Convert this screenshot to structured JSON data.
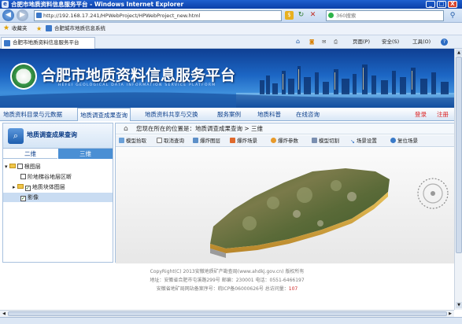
{
  "window": {
    "title": "合肥市地质资料信息服务平台 - Windows Internet Explorer",
    "min": "_",
    "max": "□",
    "close": "X"
  },
  "browser": {
    "back": "◀",
    "forward": "▶",
    "url": "http://192.168.17.241/HPWebProject/HPWebProject_new.html",
    "search_placeholder": "360搜索",
    "favorites_label": "收藏夹",
    "fav_link": "合肥城市地质信息系统",
    "tab_title": "合肥市地质资料信息服务平台",
    "cmd_page": "页面(P)",
    "cmd_safety": "安全(S)",
    "cmd_tools": "工具(O)",
    "cmd_help": "?"
  },
  "site": {
    "title": "合肥市地质资料信息服务平台",
    "subtitle": "HEFEI GEOLOGICAL DATA INFORMATION SERVICE PLATFORM"
  },
  "nav": {
    "items": [
      "地质资料目录与元数据",
      "地质调查成果查询",
      "地质资料共享与交换",
      "服务案例",
      "地质科普",
      "在线咨询"
    ],
    "login": "登录",
    "register": "注册"
  },
  "sidebar": {
    "title": "地质调查成果查询",
    "tab_2d": "二维",
    "tab_3d": "三维",
    "tree": {
      "root": "根图层",
      "item1": "阶地梯谷地层区断",
      "item2": "地质块体图层",
      "item3": "影像"
    }
  },
  "breadcrumb": "您现在所在的位置是：地质调查成果查询 > 三维",
  "tools": [
    "模型拾取",
    "取消查询",
    "爆炸图层",
    "爆炸场景",
    "爆炸参数",
    "模型切割",
    "场景设置",
    "复位场景"
  ],
  "footer": {
    "line1": "CopyRight(C) 2013安徽地质矿产勘查局(www.ahdkj.gov.cn) 版权所有",
    "line2": "地址：安徽省合肥市屯溪路299号    邮编：230001    电话：0551-6466197",
    "line3": "安徽省地矿局网站备案序号：皖ICP备06000626号    总访问量：",
    "visits": "107"
  },
  "colors": {
    "nav_text": "#0a3d8a",
    "active_tab": "#4a8fd4",
    "red_links": "#d22"
  }
}
